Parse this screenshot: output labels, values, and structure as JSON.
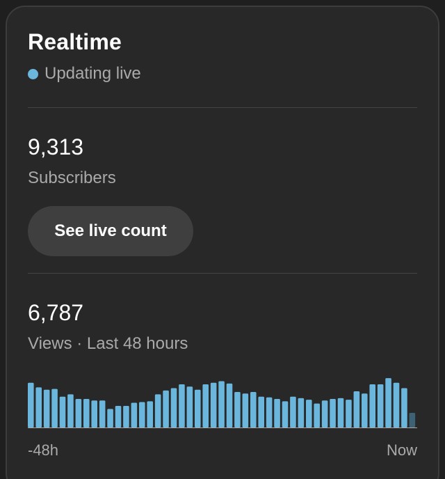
{
  "realtime": {
    "title": "Realtime",
    "status_text": "Updating live",
    "status_color": "#6ab6dd"
  },
  "subscribers": {
    "count": "9,313",
    "label": "Subscribers",
    "button_label": "See live count"
  },
  "views": {
    "count": "6,787",
    "label": "Views · Last 48 hours"
  },
  "colors": {
    "bar": "#6ab6dd",
    "bar_current": "#3e6275",
    "background": "#282828",
    "baseline": "#aaaaaa"
  },
  "chart_data": {
    "type": "bar",
    "x_start_label": "-48h",
    "x_end_label": "Now",
    "values": [
      58,
      52,
      49,
      50,
      40,
      43,
      37,
      37,
      35,
      35,
      24,
      28,
      28,
      32,
      33,
      34,
      43,
      48,
      51,
      56,
      53,
      49,
      56,
      58,
      60,
      57,
      46,
      44,
      46,
      40,
      39,
      37,
      34,
      40,
      38,
      36,
      31,
      35,
      37,
      38,
      36,
      47,
      44,
      56,
      56,
      64,
      58,
      51,
      19
    ],
    "ylim": [
      0,
      65
    ]
  }
}
